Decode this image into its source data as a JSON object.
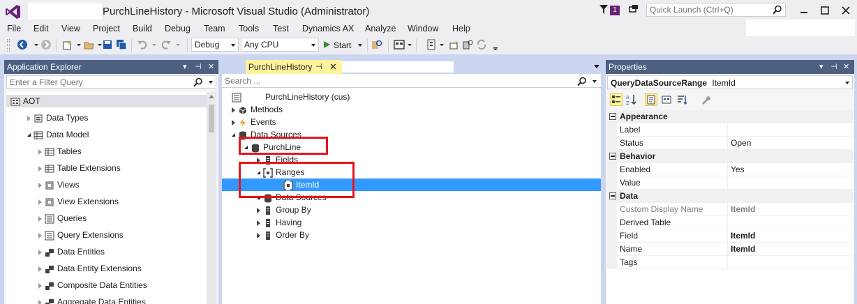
{
  "window": {
    "title": "PurchLineHistory - Microsoft Visual Studio (Administrator)",
    "notifications_count": "1",
    "quick_launch_placeholder": "Quick Launch (Ctrl+Q)"
  },
  "menu": [
    "File",
    "Edit",
    "View",
    "Project",
    "Build",
    "Debug",
    "Team",
    "Tools",
    "Test",
    "Dynamics AX",
    "Analyze",
    "Window",
    "Help"
  ],
  "toolbar": {
    "configuration": "Debug",
    "platform": "Any CPU",
    "start_label": "Start"
  },
  "app_explorer": {
    "title": "Application Explorer",
    "filter_placeholder": "Enter a Filter Query",
    "root": "AOT",
    "items": [
      {
        "label": "Data Types",
        "icon": "folder-icon"
      },
      {
        "label": "Data Model",
        "icon": "table-icon"
      },
      {
        "label": "Tables",
        "icon": "table-icon"
      },
      {
        "label": "Table Extensions",
        "icon": "table-icon"
      },
      {
        "label": "Views",
        "icon": "view-icon"
      },
      {
        "label": "View Extensions",
        "icon": "view-icon"
      },
      {
        "label": "Queries",
        "icon": "query-icon"
      },
      {
        "label": "Query Extensions",
        "icon": "query-icon"
      },
      {
        "label": "Data Entities",
        "icon": "entity-icon"
      },
      {
        "label": "Data Entity Extensions",
        "icon": "entity-icon"
      },
      {
        "label": "Composite Data Entities",
        "icon": "entity-icon"
      },
      {
        "label": "Aggregate Data Entities",
        "icon": "entity-icon"
      }
    ]
  },
  "designer": {
    "tab_title": "PurchLineHistory",
    "search_placeholder": "Search ...",
    "root_label": "PurchLineHistory (cus)",
    "nodes": {
      "methods": "Methods",
      "events": "Events",
      "data_sources": "Data Sources",
      "purchline": "PurchLine",
      "fields": "Fields",
      "ranges": "Ranges",
      "itemid": "ItemId",
      "sub_data_sources": "Data Sources",
      "group_by": "Group By",
      "having": "Having",
      "order_by": "Order By"
    }
  },
  "properties": {
    "title": "Properties",
    "object_type": "QueryDataSourceRange",
    "object_name": "ItemId",
    "categories": [
      {
        "name": "Appearance",
        "rows": [
          {
            "name": "Label",
            "value": ""
          },
          {
            "name": "Status",
            "value": "Open"
          }
        ]
      },
      {
        "name": "Behavior",
        "rows": [
          {
            "name": "Enabled",
            "value": "Yes"
          },
          {
            "name": "Value",
            "value": ""
          }
        ]
      },
      {
        "name": "Data",
        "rows": [
          {
            "name": "Custom Display Name",
            "value": "ItemId"
          },
          {
            "name": "Derived Table",
            "value": ""
          },
          {
            "name": "Field",
            "value": "ItemId"
          },
          {
            "name": "Name",
            "value": "ItemId"
          },
          {
            "name": "Tags",
            "value": ""
          }
        ]
      }
    ]
  },
  "colors": {
    "accent_purple": "#68217a",
    "panel_header": "#4d6082",
    "active_tab": "#fff29d",
    "selection": "#3399ff",
    "highlight_box": "#e8141c"
  }
}
